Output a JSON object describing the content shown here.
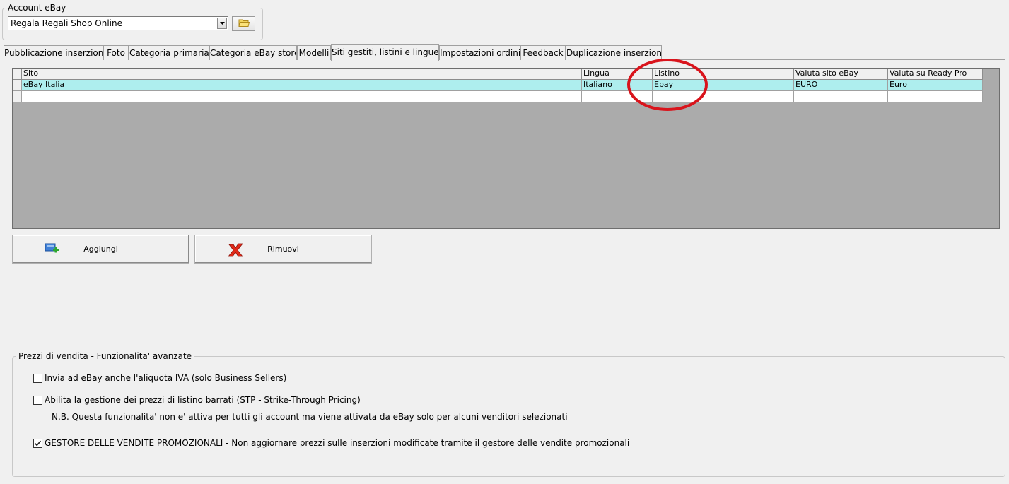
{
  "account": {
    "legend": "Account eBay",
    "selected": "Regala Regali Shop Online"
  },
  "tabs": [
    {
      "label": "Pubblicazione inserzioni"
    },
    {
      "label": "Foto"
    },
    {
      "label": "Categoria primaria"
    },
    {
      "label": "Categoria eBay store"
    },
    {
      "label": "Modelli"
    },
    {
      "label": "Siti gestiti, listini e lingue",
      "active": true
    },
    {
      "label": "Impostazioni ordini"
    },
    {
      "label": "Feedback"
    },
    {
      "label": "Duplicazione inserzioni"
    }
  ],
  "grid": {
    "columns": [
      "Sito",
      "Lingua",
      "Listino",
      "Valuta sito eBay",
      "Valuta su Ready Pro"
    ],
    "rows": [
      [
        "eBay Italia",
        "Italiano",
        "Ebay",
        "EURO",
        "Euro"
      ]
    ],
    "highlight_color": "#aeeeee",
    "annotation_color": "#d9141c"
  },
  "buttons": {
    "add_label": "Aggiungi",
    "remove_label": "Rimuovi"
  },
  "prices": {
    "legend": "Prezzi di vendita - Funzionalita' avanzate",
    "options": [
      {
        "label": "Invia ad eBay anche l'aliquota IVA (solo Business Sellers)",
        "checked": false
      },
      {
        "label": "Abilita la gestione dei prezzi di listino barrati (STP - Strike-Through Pricing)",
        "checked": false
      },
      {
        "label": "GESTORE DELLE VENDITE PROMOZIONALI - Non aggiornare prezzi sulle inserzioni modificate tramite il gestore delle vendite promozionali",
        "checked": true
      }
    ],
    "note": "N.B. Questa funzionalita' non e' attiva per tutti gli account ma viene attivata da eBay solo per alcuni venditori selezionati"
  }
}
